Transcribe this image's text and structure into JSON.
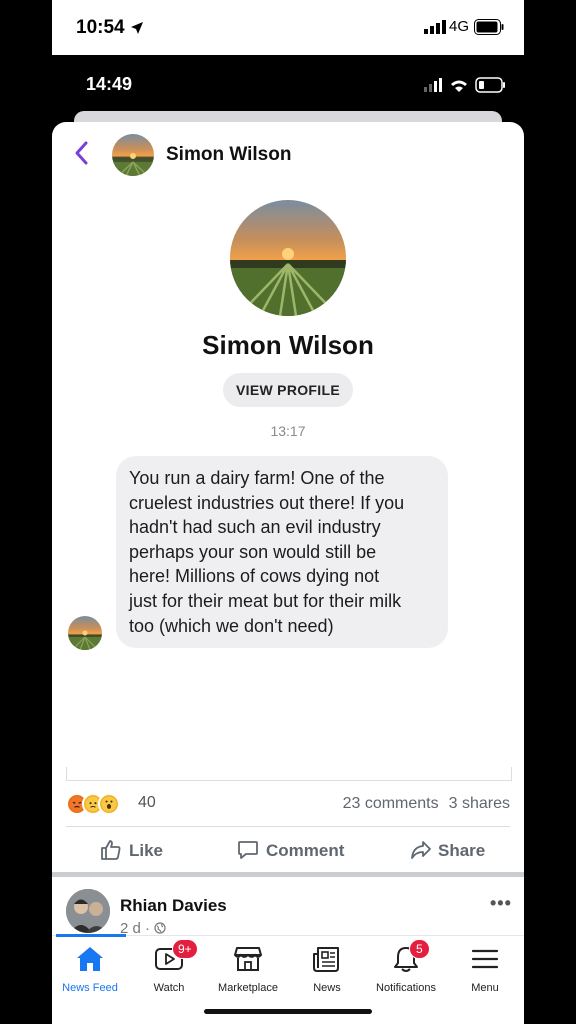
{
  "outer_status": {
    "time": "10:54",
    "network": "4G"
  },
  "inner_status": {
    "time": "14:49"
  },
  "messenger": {
    "header_name": "Simon Wilson",
    "profile_name": "Simon Wilson",
    "view_profile_label": "VIEW PROFILE",
    "timestamp": "13:17",
    "message_lines": [
      "You run a dairy farm! One of the",
      "cruelest industries out there! If you",
      "hadn't had such an evil industry",
      "perhaps your son would still be",
      "here! Millions of cows dying not",
      "just for their meat but for their milk",
      "too (which we don't need)"
    ]
  },
  "post_footer": {
    "reactions": [
      "angry-icon",
      "sad-icon",
      "wow-icon"
    ],
    "reaction_count": "40",
    "comments": "23 comments",
    "shares": "3 shares",
    "actions": {
      "like": "Like",
      "comment": "Comment",
      "share": "Share"
    }
  },
  "next_post": {
    "author": "Rhian Davies",
    "meta": "2 d ·"
  },
  "tabbar": {
    "items": [
      {
        "label": "News Feed",
        "icon": "home-icon",
        "active": true
      },
      {
        "label": "Watch",
        "icon": "watch-icon",
        "badge": "9+"
      },
      {
        "label": "Marketplace",
        "icon": "marketplace-icon"
      },
      {
        "label": "News",
        "icon": "news-icon"
      },
      {
        "label": "Notifications",
        "icon": "bell-icon",
        "badge": "5"
      },
      {
        "label": "Menu",
        "icon": "menu-icon"
      }
    ]
  },
  "colors": {
    "accent": "#1877f2",
    "badge": "#e41e3f",
    "back_arrow": "#7b3fd6"
  }
}
